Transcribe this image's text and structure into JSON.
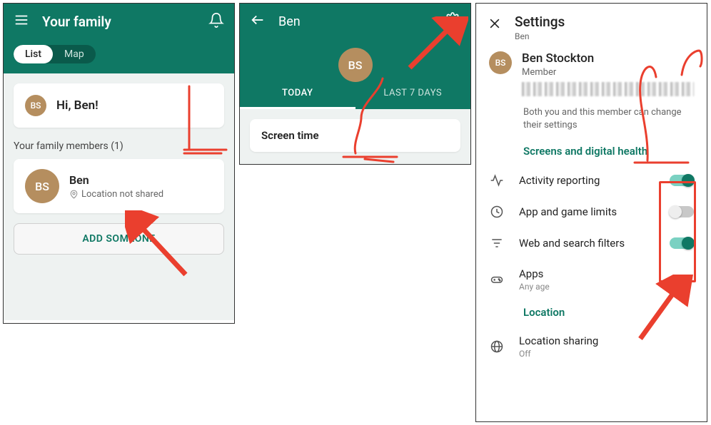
{
  "panel1": {
    "title": "Your family",
    "tabs": {
      "list": "List",
      "map": "Map"
    },
    "greeting_avatar": "BS",
    "greeting": "Hi, Ben!",
    "section_label": "Your family members (1)",
    "member": {
      "avatar": "BS",
      "name": "Ben",
      "sub": "Location not shared"
    },
    "add_button": "ADD SOMEONE"
  },
  "panel2": {
    "title": "Ben",
    "avatar": "BS",
    "tabs": {
      "today": "TODAY",
      "last7": "LAST 7 DAYS"
    },
    "screen_time_label": "Screen time"
  },
  "panel3": {
    "title": "Settings",
    "subtitle": "Ben",
    "profile": {
      "avatar": "BS",
      "name": "Ben Stockton",
      "role": "Member"
    },
    "note": "Both you and this member can change their settings",
    "sections": {
      "screens_h": "Screens and digital health",
      "activity": "Activity reporting",
      "limits": "App and game limits",
      "filters": "Web and search filters",
      "apps": "Apps",
      "apps_sub": "Any age",
      "location_h": "Location",
      "loc_sharing": "Location sharing",
      "loc_sub": "Off"
    },
    "toggles": {
      "activity": true,
      "limits": false,
      "filters": true
    }
  },
  "colors": {
    "brand": "#0f7864",
    "avatar": "#b58e5f",
    "annot": "#ea3f2e"
  }
}
